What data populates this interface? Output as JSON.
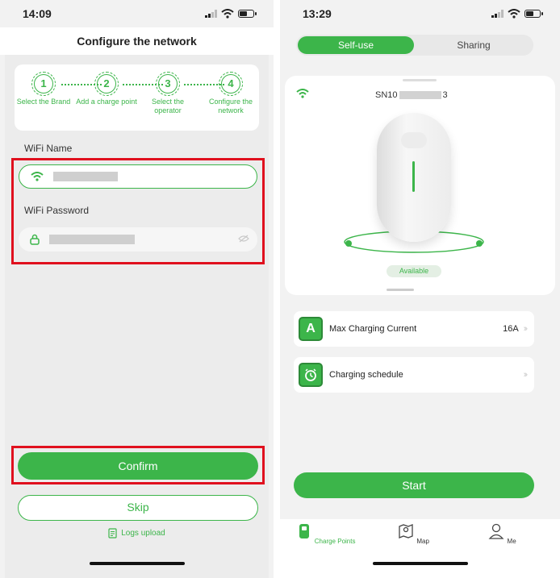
{
  "left": {
    "status": {
      "time": "14:09"
    },
    "title": "Configure the network",
    "steps": [
      {
        "num": "1",
        "label": "Select the Brand"
      },
      {
        "num": "2",
        "label": "Add a charge point"
      },
      {
        "num": "3",
        "label": "Select the operator"
      },
      {
        "num": "4",
        "label": "Configure the network"
      }
    ],
    "wifi_name_label": "WiFi Name",
    "wifi_password_label": "WiFi Password",
    "confirm_label": "Confirm",
    "skip_label": "Skip",
    "logs_label": "Logs upload"
  },
  "right": {
    "status": {
      "time": "13:29"
    },
    "segment": {
      "active": "Self-use",
      "inactive": "Sharing"
    },
    "serial": {
      "prefix": "SN10",
      "suffix": "3"
    },
    "availability": "Available",
    "settings": [
      {
        "icon_letter": "A",
        "label": "Max Charging Current",
        "value": "16A"
      },
      {
        "icon_letter": "",
        "label": "Charging schedule",
        "value": ""
      }
    ],
    "start_label": "Start",
    "tabs": [
      {
        "label": "Charge Points",
        "icon": "charger-icon"
      },
      {
        "label": "Map",
        "icon": "map-icon"
      },
      {
        "label": "Me",
        "icon": "person-icon"
      }
    ]
  },
  "colors": {
    "accent": "#3cb54a",
    "highlight": "#e0101e"
  }
}
